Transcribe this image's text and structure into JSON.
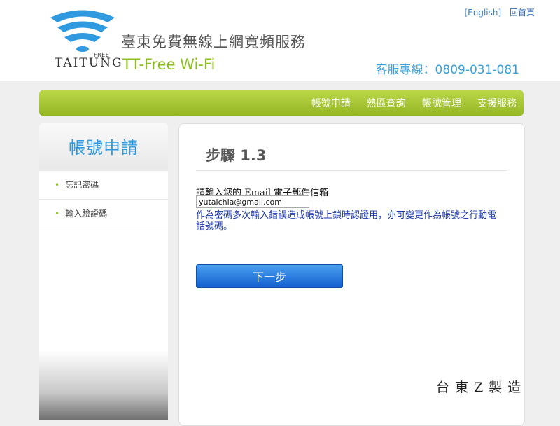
{
  "header": {
    "logo": {
      "text": "TAITUNG",
      "free": "FREE"
    },
    "title": "臺東免費無線上網寬頻服務",
    "subtitle": "TT-Free Wi-Fi",
    "links": {
      "english": "[English]",
      "home": "回首頁"
    },
    "hotline": "客服專線：0809-031-081"
  },
  "nav": {
    "items": [
      "帳號申請",
      "熱區查詢",
      "帳號管理",
      "支援服務"
    ]
  },
  "sidebar": {
    "title": "帳號申請",
    "items": [
      {
        "label": "忘記密碼"
      },
      {
        "label": "輸入驗證碼"
      }
    ]
  },
  "main": {
    "step": "步驟 1.3",
    "email_prompt": "請輸入您的 Email 電子郵件信箱",
    "email_value": "yutaichia@gmail.com",
    "note": "作為密碼多次輸入錯誤造成帳號上鎖時認證用，亦可變更作為帳號之行動電話號碼。",
    "next_button": "下一步"
  },
  "footer": {
    "made_in": "台東Z製造"
  },
  "colors": {
    "accent_green": "#8cbf1f",
    "accent_blue": "#2f9ae0",
    "note_blue": "#1a36a8",
    "button_blue": "#1360d0"
  },
  "icons": {
    "logo": "wifi-signal-icon"
  }
}
